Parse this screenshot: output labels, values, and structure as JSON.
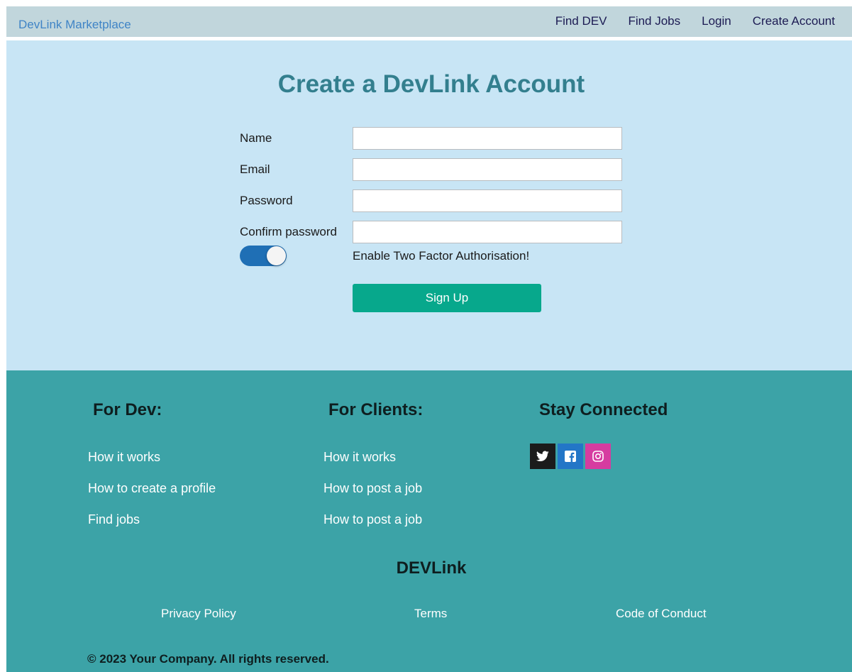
{
  "navbar": {
    "brand": "DevLink Marketplace",
    "links": [
      "Find DEV",
      "Find Jobs",
      "Login",
      "Create Account"
    ]
  },
  "signup": {
    "title": "Create a DevLink Account",
    "fields": [
      {
        "label": "Name",
        "value": ""
      },
      {
        "label": "Email",
        "value": ""
      },
      {
        "label": "Password",
        "value": ""
      },
      {
        "label": "Confirm password",
        "value": ""
      }
    ],
    "two_factor": {
      "label": "Enable Two Factor Authorisation!",
      "enabled": true
    },
    "submit_label": "Sign Up"
  },
  "footer": {
    "dev": {
      "heading": "For Dev:",
      "links": [
        "How it works",
        "How to create a profile",
        "Find jobs"
      ]
    },
    "clients": {
      "heading": "For Clients:",
      "links": [
        "How it works",
        "How to post a job",
        "How to post a job"
      ]
    },
    "social": {
      "heading": "Stay Connected",
      "icons": [
        {
          "name": "twitter-icon",
          "color": "#1b1b1b"
        },
        {
          "name": "facebook-icon",
          "color": "#2376c7"
        },
        {
          "name": "instagram-icon",
          "color": "#d63ca0"
        }
      ]
    },
    "brand": "DEVLink",
    "legal": [
      "Privacy Policy",
      "Terms",
      "Code of Conduct"
    ],
    "copyright": "© 2023 Your Company. All rights reserved."
  },
  "colors": {
    "navbar_bg": "#c1d6dc",
    "main_bg": "#c8e5f5",
    "title": "#337f8e",
    "button": "#07a88c",
    "toggle": "#1f6fb5",
    "footer_bg": "#3ca3a7"
  }
}
